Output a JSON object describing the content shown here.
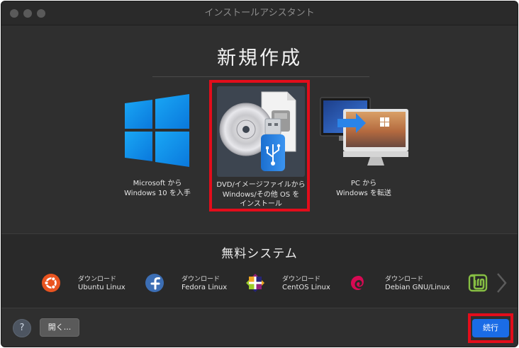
{
  "window": {
    "title": "インストールアシスタント"
  },
  "new_section": {
    "title": "新規作成",
    "options": [
      {
        "label": "Microsoft から\nWindows 10 を入手",
        "icon": "windows-logo-icon"
      },
      {
        "label": "DVD/イメージファイルから\nWindows/その他 OS を\nインストール",
        "icon": "dvd-usb-image-icon",
        "selected": true
      },
      {
        "label": "PC から\nWindows を転送",
        "icon": "pc-to-mac-transfer-icon"
      }
    ]
  },
  "free_section": {
    "title": "無料システム",
    "distros": [
      {
        "top": "ダウンロード",
        "name": "Ubuntu Linux",
        "icon": "ubuntu-logo-icon"
      },
      {
        "top": "ダウンロード",
        "name": "Fedora Linux",
        "icon": "fedora-logo-icon"
      },
      {
        "top": "ダウンロード",
        "name": "CentOS Linux",
        "icon": "centos-logo-icon"
      },
      {
        "top": "ダウンロード",
        "name": "Debian GNU/Linux",
        "icon": "debian-logo-icon"
      },
      {
        "top": "",
        "name": "",
        "icon": "linux-mint-logo-icon"
      }
    ]
  },
  "footer": {
    "help_label": "?",
    "open_label": "開く...",
    "continue_label": "続行"
  },
  "colors": {
    "highlight": "#e30d1b",
    "accent": "#1a6ce6",
    "background": "#2f2f2f"
  }
}
